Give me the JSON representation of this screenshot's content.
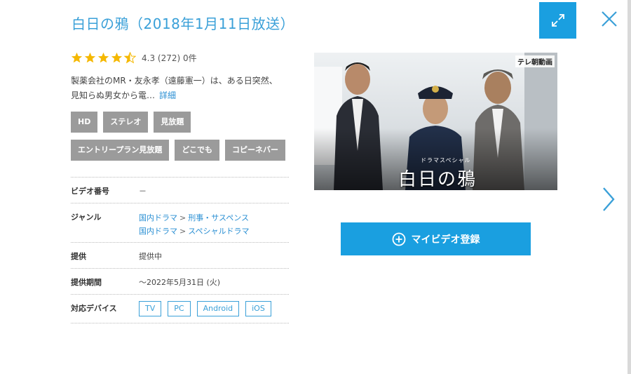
{
  "header": {
    "title": "白日の鴉（2018年1月11日放送）",
    "expand_icon": "expand-icon",
    "close_icon": "close-icon"
  },
  "rating": {
    "value": 4.3,
    "text": "4.3 (272) 0件",
    "stars_full": 4,
    "star_half": true,
    "star_color": "#f5b800"
  },
  "description": {
    "line1": "製薬会社のMR・友永孝（遠藤憲一）は、ある日突然、",
    "line2": "見知らぬ男女から電…",
    "more_label": "詳細"
  },
  "tags": {
    "row1": [
      "HD",
      "ステレオ",
      "見放題"
    ],
    "row2": [
      "エントリープラン見放題",
      "どこでも",
      "コピーネバー"
    ]
  },
  "info": {
    "video_number_label": "ビデオ番号",
    "video_number_value": "－",
    "genre_label": "ジャンル",
    "genre1_parent": "国内ドラマ",
    "genre1_child": "刑事・サスペンス",
    "genre2_parent": "国内ドラマ",
    "genre2_child": "スペシャルドラマ",
    "separator": ">",
    "provider_label": "提供",
    "provider_value": "提供中",
    "period_label": "提供期間",
    "period_value": "～2022年5月31日 (火)",
    "devices_label": "対応デバイス",
    "devices": [
      "TV",
      "PC",
      "Android",
      "iOS"
    ]
  },
  "thumbnail": {
    "badge": "テレ朝動画",
    "subtitle": "ドラマスペシャル",
    "title": "白日の鴉"
  },
  "register_button": {
    "label": "マイビデオ登録",
    "icon": "plus-circle-icon"
  },
  "nav": {
    "next_icon": "chevron-right-icon"
  },
  "colors": {
    "accent": "#1a9fe0",
    "title": "#3aa0d8",
    "link": "#2a8fd3",
    "tag_bg": "#9b9b9b"
  }
}
